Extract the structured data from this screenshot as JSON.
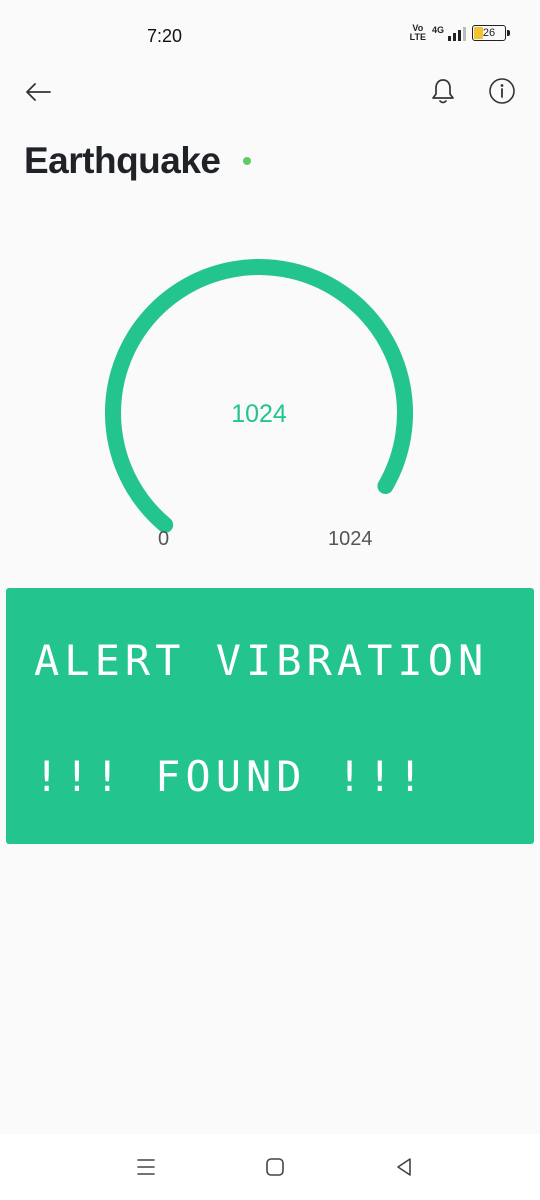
{
  "status_bar": {
    "time": "7:20",
    "volte_top": "Vo",
    "volte_bottom": "LTE",
    "network": "4G",
    "battery": "26"
  },
  "app_bar": {
    "back_icon": "arrow-left-icon",
    "bell_icon": "bell-icon",
    "info_icon": "info-icon"
  },
  "title": "Earthquake",
  "status_color": "#5ecc62",
  "gauge": {
    "value": "1024",
    "min": "0",
    "max": "1024",
    "fill_fraction": 1.0,
    "color": "#23c48e"
  },
  "lcd": {
    "line1": "ALERT VIBRATION",
    "line2": "!!! FOUND !!!",
    "background": "#23c48e"
  },
  "nav_bar": {
    "menu_icon": "menu-icon",
    "home_icon": "home-square-icon",
    "back_icon": "back-triangle-icon"
  }
}
